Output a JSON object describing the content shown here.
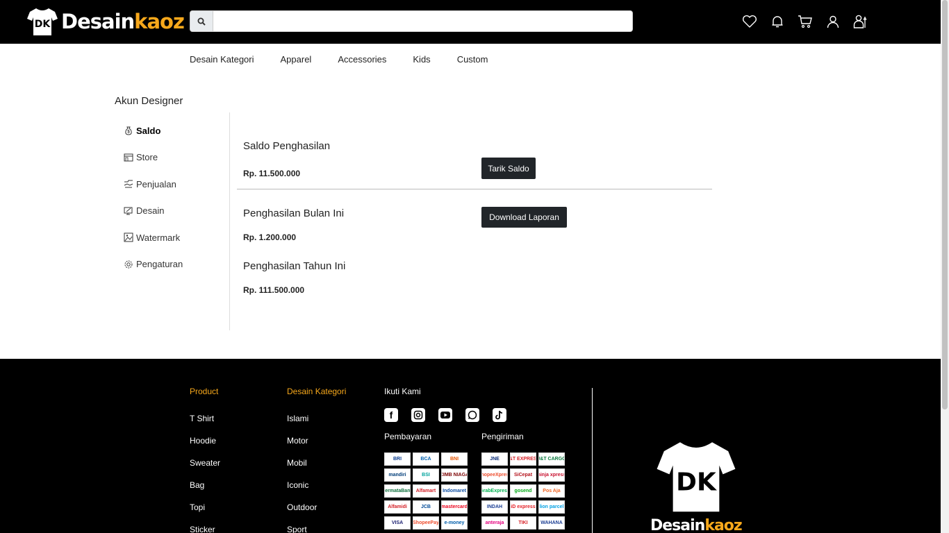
{
  "header": {
    "logo": {
      "text_white": "Desain",
      "text_yellow": "kaoz",
      "mark": "DK"
    },
    "search": {
      "placeholder": "",
      "value": ""
    },
    "icons": [
      "heart-icon",
      "bell-icon",
      "cart-icon",
      "user-icon",
      "designer-icon"
    ]
  },
  "nav": [
    "Desain Kategori",
    "Apparel",
    "Accessories",
    "Kids",
    "Custom"
  ],
  "sidebar": {
    "title": "Akun Designer",
    "items": [
      {
        "label": "Saldo",
        "icon": "money-bag-icon",
        "active": true
      },
      {
        "label": "Store",
        "icon": "store-icon",
        "active": false
      },
      {
        "label": "Penjualan",
        "icon": "sales-icon",
        "active": false
      },
      {
        "label": "Desain",
        "icon": "design-icon",
        "active": false
      },
      {
        "label": "Watermark",
        "icon": "watermark-icon",
        "active": false
      },
      {
        "label": "Pengaturan",
        "icon": "settings-icon",
        "active": false
      }
    ]
  },
  "main": {
    "saldo_title": "Saldo Penghasilan",
    "saldo_value": "Rp. 11.500.000",
    "tarik_button": "Tarik Saldo",
    "bulan_title": "Penghasilan Bulan Ini",
    "bulan_value": "Rp. 1.200.000",
    "download_button": "Download Laporan",
    "tahun_title": "Penghasilan Tahun Ini",
    "tahun_value": "Rp. 111.500.000"
  },
  "footer": {
    "product_title": "Product",
    "products": [
      "T Shirt",
      "Hoodie",
      "Sweater",
      "Bag",
      "Topi",
      "Sticker"
    ],
    "kategori_title": "Desain Kategori",
    "kategori": [
      "Islami",
      "Motor",
      "Mobil",
      "Iconic",
      "Outdoor",
      "Sport"
    ],
    "ikuti_title": "Ikuti Kami",
    "social": [
      "facebook-icon",
      "instagram-icon",
      "youtube-icon",
      "whatsapp-icon",
      "tiktok-icon"
    ],
    "pembayaran_title": "Pembayaran",
    "payments": [
      "BRI",
      "BCA",
      "BNI",
      "mandiri",
      "BSI",
      "CIMB NIAGA",
      "PermataBank",
      "Alfamart",
      "Indomaret",
      "Alfamidi",
      "JCB",
      "mastercard",
      "VISA",
      "ShopeePay",
      "e-money"
    ],
    "pengiriman_title": "Pengiriman",
    "shipping": [
      "JNE",
      "J&T EXPRESS",
      "J&T CARGO",
      "ShopeeXpress",
      "SiCepat",
      "ninja xpress",
      "GrabExpress",
      "gosend",
      "Pos Aja",
      "INDAH",
      "iD express",
      "lion parcel",
      "anteraja",
      "TIKI",
      "WAHANA"
    ],
    "logo": {
      "text_white": "Desain",
      "text_yellow": "kaoz",
      "mark": "DK"
    }
  },
  "colors": {
    "accent": "#f7a81b",
    "header_bg": "#000000",
    "button_bg": "#212529"
  }
}
